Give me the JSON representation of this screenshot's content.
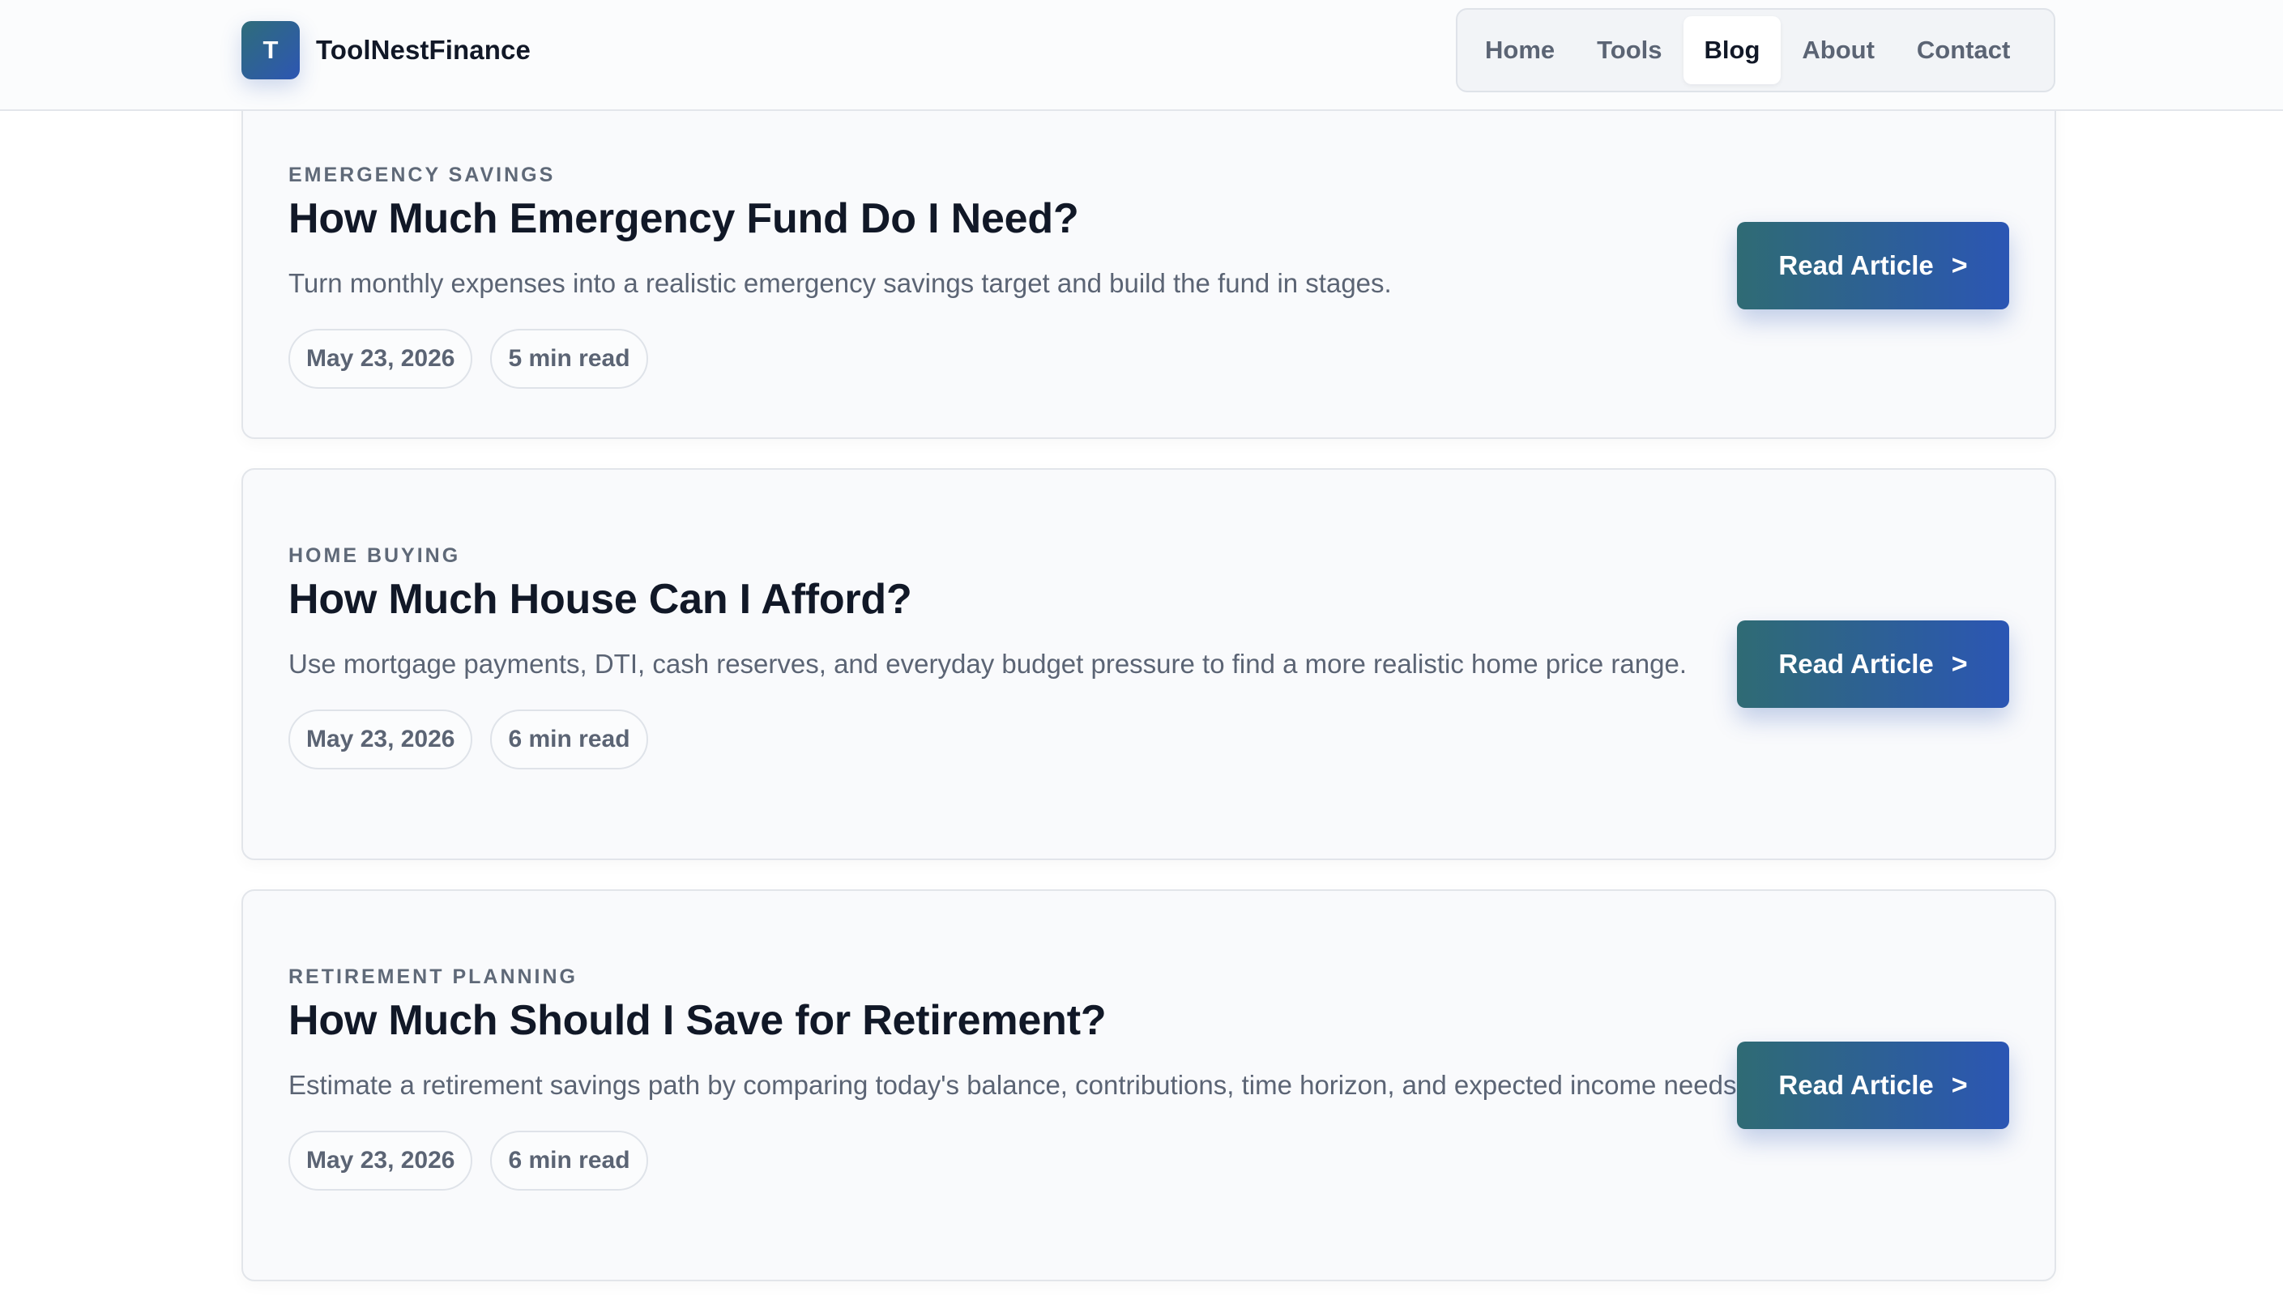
{
  "brand": {
    "logo_letter": "T",
    "name": "ToolNestFinance"
  },
  "nav": {
    "items": [
      {
        "label": "Home",
        "active": false
      },
      {
        "label": "Tools",
        "active": false
      },
      {
        "label": "Blog",
        "active": true
      },
      {
        "label": "About",
        "active": false
      },
      {
        "label": "Contact",
        "active": false
      }
    ]
  },
  "articles": [
    {
      "category": "EMERGENCY SAVINGS",
      "title": "How Much Emergency Fund Do I Need?",
      "excerpt": "Turn monthly expenses into a realistic emergency savings target and build the fund in stages.",
      "date": "May 23, 2026",
      "read_time": "5 min read",
      "button_label": "Read Article",
      "button_icon": ">"
    },
    {
      "category": "HOME BUYING",
      "title": "How Much House Can I Afford?",
      "excerpt": "Use mortgage payments, DTI, cash reserves, and everyday budget pressure to find a more realistic home price range.",
      "date": "May 23, 2026",
      "read_time": "6 min read",
      "button_label": "Read Article",
      "button_icon": ">"
    },
    {
      "category": "RETIREMENT PLANNING",
      "title": "How Much Should I Save for Retirement?",
      "excerpt": "Estimate a retirement savings path by comparing today's balance, contributions, time horizon, and expected income needs.",
      "date": "May 23, 2026",
      "read_time": "6 min read",
      "button_label": "Read Article",
      "button_icon": ">"
    }
  ],
  "colors": {
    "accent_start": "#2f6b74",
    "accent_end": "#2b56b4",
    "heading": "#111827",
    "muted_text": "#5b6474"
  }
}
